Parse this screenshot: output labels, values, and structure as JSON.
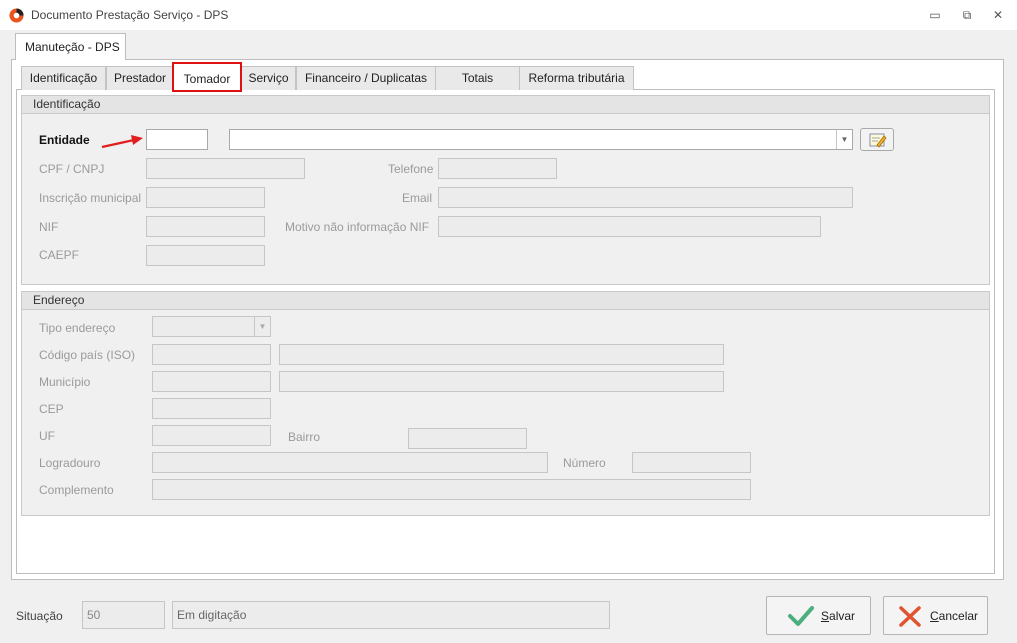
{
  "window": {
    "title": "Documento Prestação Serviço - DPS",
    "minimize_glyph": "▭",
    "maximize_glyph": "⧉",
    "close_glyph": "✕"
  },
  "outer_tab": {
    "label": "Manuteção - DPS"
  },
  "tabs": [
    {
      "label": "Identificação"
    },
    {
      "label": "Prestador"
    },
    {
      "label": "Tomador",
      "active": true
    },
    {
      "label": "Serviço"
    },
    {
      "label": "Financeiro / Duplicatas"
    },
    {
      "label": "Totais"
    },
    {
      "label": "Reforma tributária"
    }
  ],
  "identificacao": {
    "header": "Identificação",
    "entidade_label": "Entidade",
    "entidade_code": "",
    "entidade_name": "",
    "cpf_label": "CPF /  CNPJ",
    "telefone_label": "Telefone",
    "inscricao_label": "Inscrição municipal",
    "email_label": "Email",
    "nif_label": "NIF",
    "motivo_label": "Motivo não informação NIF",
    "caepf_label": "CAEPF"
  },
  "endereco": {
    "header": "Endereço",
    "tipo_label": "Tipo endereço",
    "codigo_pais_label": "Código país (ISO)",
    "municipio_label": "Município",
    "cep_label": "CEP",
    "uf_label": "UF",
    "bairro_label": "Bairro",
    "logradouro_label": "Logradouro",
    "numero_label": "Número",
    "complemento_label": "Complemento"
  },
  "footer": {
    "situacao_label": "Situação",
    "situacao_code": "50",
    "situacao_text": "Em digitação",
    "salvar_first": "S",
    "salvar_rest": "alvar",
    "cancelar_first": "C",
    "cancelar_rest": "ancelar"
  },
  "colors": {
    "active_tab_border": "#e01010",
    "arrow": "#e02020",
    "save_check": "#4caf7d",
    "cancel_x": "#e0542f"
  }
}
